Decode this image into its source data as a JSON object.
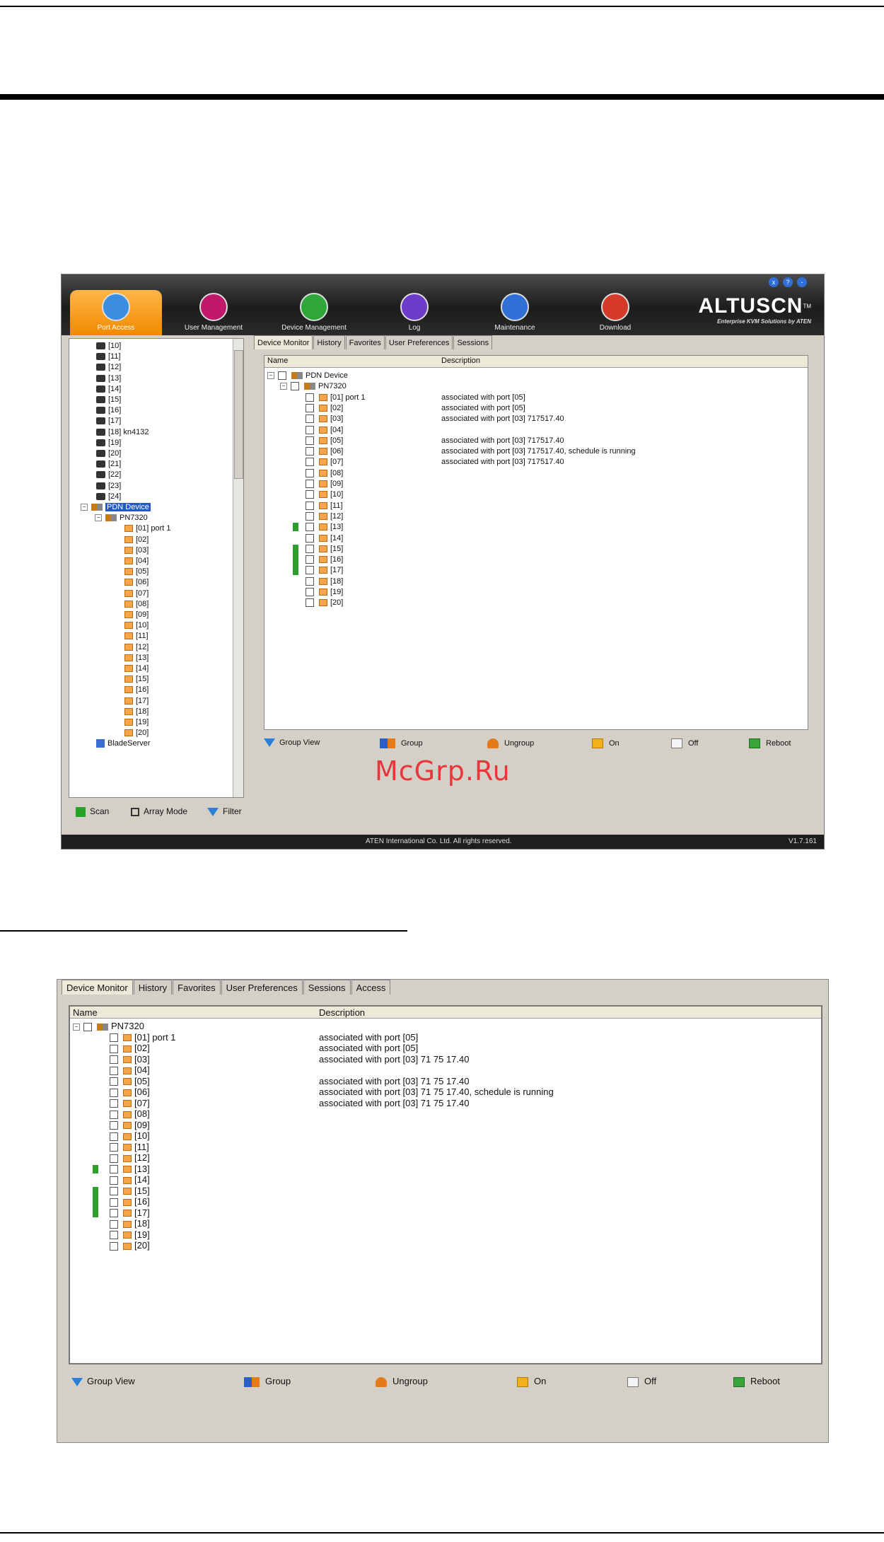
{
  "app": {
    "brand_name": "ALTUSCN",
    "brand_tm": "TM",
    "brand_tagline": "Enterprise KVM Solutions by ATEN",
    "nav_tabs": [
      "Port Access",
      "User Management",
      "Device Management",
      "Log",
      "Maintenance",
      "Download"
    ],
    "window_buttons": [
      "x",
      "?",
      "-"
    ],
    "copyright": "ATEN International Co. Ltd. All rights reserved.",
    "version": "V1.7.161"
  },
  "left_tree": {
    "ports": [
      "[10]",
      "[11]",
      "[12]",
      "[13]",
      "[14]",
      "[15]",
      "[16]",
      "[17]",
      "[18] kn4132",
      "[19]",
      "[20]",
      "[21]",
      "[22]",
      "[23]",
      "[24]"
    ],
    "pdn_device": "PDN Device",
    "pn7320": "PN7320",
    "pdn_ports": [
      "[01] port 1",
      "[02]",
      "[03]",
      "[04]",
      "[05]",
      "[06]",
      "[07]",
      "[08]",
      "[09]",
      "[10]",
      "[11]",
      "[12]",
      "[13]",
      "[14]",
      "[15]",
      "[16]",
      "[17]",
      "[18]",
      "[19]",
      "[20]"
    ],
    "blade": "BladeServer"
  },
  "left_bar": {
    "scan": "Scan",
    "array_mode": "Array Mode",
    "filter": "Filter"
  },
  "tabs1": [
    "Device Monitor",
    "History",
    "Favorites",
    "User Preferences",
    "Sessions"
  ],
  "tabs2": [
    "Device Monitor",
    "History",
    "Favorites",
    "User Preferences",
    "Sessions",
    "Access"
  ],
  "list": {
    "col_name": "Name",
    "col_desc": "Description",
    "pdn_device": "PDN Device",
    "pn7320": "PN7320",
    "ports": [
      {
        "name": "[01] port 1",
        "desc": "associated with port [05]"
      },
      {
        "name": "[02]",
        "desc": "associated with port [05]"
      },
      {
        "name": "[03]",
        "desc": "associated with port [03] 717517.40"
      },
      {
        "name": "[04]",
        "desc": ""
      },
      {
        "name": "[05]",
        "desc": "associated with port [03] 717517.40"
      },
      {
        "name": "[06]",
        "desc": "associated with port [03] 717517.40, schedule is running"
      },
      {
        "name": "[07]",
        "desc": "associated with port [03] 717517.40"
      },
      {
        "name": "[08]",
        "desc": ""
      },
      {
        "name": "[09]",
        "desc": ""
      },
      {
        "name": "[10]",
        "desc": ""
      },
      {
        "name": "[11]",
        "desc": ""
      },
      {
        "name": "[12]",
        "desc": ""
      },
      {
        "name": "[13]",
        "desc": ""
      },
      {
        "name": "[14]",
        "desc": ""
      },
      {
        "name": "[15]",
        "desc": ""
      },
      {
        "name": "[16]",
        "desc": ""
      },
      {
        "name": "[17]",
        "desc": ""
      },
      {
        "name": "[18]",
        "desc": ""
      },
      {
        "name": "[19]",
        "desc": ""
      },
      {
        "name": "[20]",
        "desc": ""
      }
    ],
    "ports2_desc": [
      "associated with port [05]",
      "associated with port [05]",
      "associated with port [03] 71 75 17.40",
      "",
      "associated with port [03] 71 75 17.40",
      "associated with port [03] 71 75 17.40, schedule is running",
      "associated with port [03] 71 75 17.40"
    ]
  },
  "actions": {
    "group_view": "Group View",
    "group": "Group",
    "ungroup": "Ungroup",
    "on": "On",
    "off": "Off",
    "reboot": "Reboot"
  },
  "watermark": "McGrp.Ru"
}
